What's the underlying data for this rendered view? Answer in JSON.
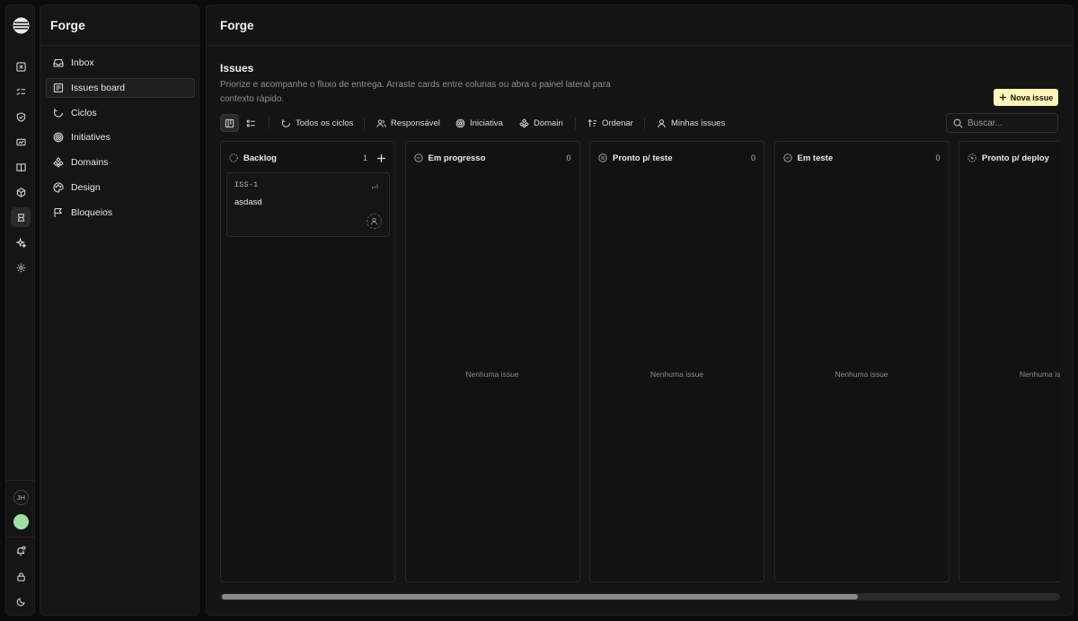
{
  "app": {
    "name": "Forge"
  },
  "rail": {
    "icons": [
      "close-square-icon",
      "checklist-icon",
      "shield-icon",
      "card-icon",
      "book-icon",
      "cube-icon",
      "board-icon",
      "sparkle-icon",
      "gear-icon"
    ],
    "active_index": 6,
    "user_initials": "JH",
    "bottom_icons": [
      "bell-icon",
      "lock-icon",
      "moon-icon"
    ]
  },
  "sidebar": {
    "title": "Forge",
    "items": [
      {
        "label": "Inbox",
        "icon": "inbox-icon",
        "active": false
      },
      {
        "label": "Issues board",
        "icon": "board-icon",
        "active": true
      },
      {
        "label": "Ciclos",
        "icon": "cycle-icon",
        "active": false
      },
      {
        "label": "Initiatives",
        "icon": "target-icon",
        "active": false
      },
      {
        "label": "Domains",
        "icon": "domains-icon",
        "active": false
      },
      {
        "label": "Design",
        "icon": "palette-icon",
        "active": false
      },
      {
        "label": "Bloqueios",
        "icon": "flag-icon",
        "active": false
      }
    ]
  },
  "header": {
    "title": "Forge"
  },
  "page": {
    "title": "Issues",
    "description": "Priorize e acompanhe o fluxo de entrega. Arraste cards entre colunas ou abra o painel lateral para contexto rápido.",
    "new_issue_label": "Nova issue"
  },
  "toolbar": {
    "filters": {
      "cycles": "Todos os ciclos",
      "assignee": "Responsável",
      "initiative": "Iniciativa",
      "domain": "Domain",
      "sort": "Ordenar",
      "mine": "Minhas issues"
    },
    "search_placeholder": "Buscar..."
  },
  "board": {
    "empty_label": "Nenhuma issue",
    "columns": [
      {
        "name": "Backlog",
        "count": "1"
      },
      {
        "name": "Em progresso",
        "count": "0"
      },
      {
        "name": "Pronto p/ teste",
        "count": "0"
      },
      {
        "name": "Em teste",
        "count": "0"
      },
      {
        "name": "Pronto p/ deploy",
        "count": ""
      }
    ],
    "cards": [
      {
        "column": "Backlog",
        "key": "ISS-1",
        "title": "asdasd"
      }
    ]
  },
  "colors": {
    "accent": "#fff5b8",
    "avatar": "#9de2a0",
    "background": "#0b0b0b",
    "panel": "#151515"
  }
}
